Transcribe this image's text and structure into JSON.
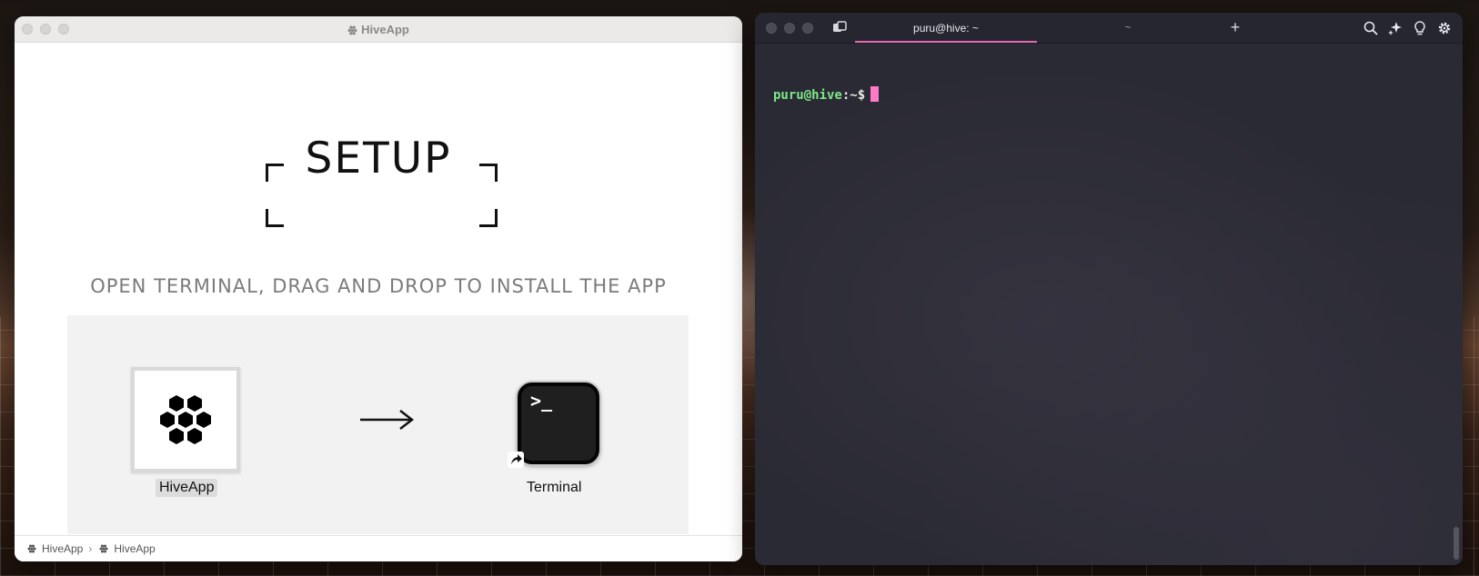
{
  "hive_window": {
    "title": "HiveApp",
    "heading": "SETUP",
    "instruction": "OPEN TERMINAL, DRAG AND DROP TO INSTALL THE APP",
    "app_icon": "hive-icon",
    "app_label": "HiveApp",
    "target_icon": "terminal-icon",
    "target_prompt": ">_",
    "target_label": "Terminal",
    "breadcrumb": [
      "HiveApp",
      "HiveApp"
    ]
  },
  "terminal_window": {
    "tabs": [
      {
        "label": "puru@hive: ~",
        "active": true
      },
      {
        "label": "~",
        "active": false
      }
    ],
    "prompt": {
      "user_host": "puru@hive",
      "separator": ":",
      "path": "~",
      "symbol": "$"
    },
    "accent_color": "#e36ab5",
    "cursor_color": "#ff79c6",
    "prompt_color": "#7ee787",
    "toolbar_icons": [
      "search-icon",
      "sparkle-icon",
      "lightbulb-icon",
      "gear-icon"
    ]
  }
}
